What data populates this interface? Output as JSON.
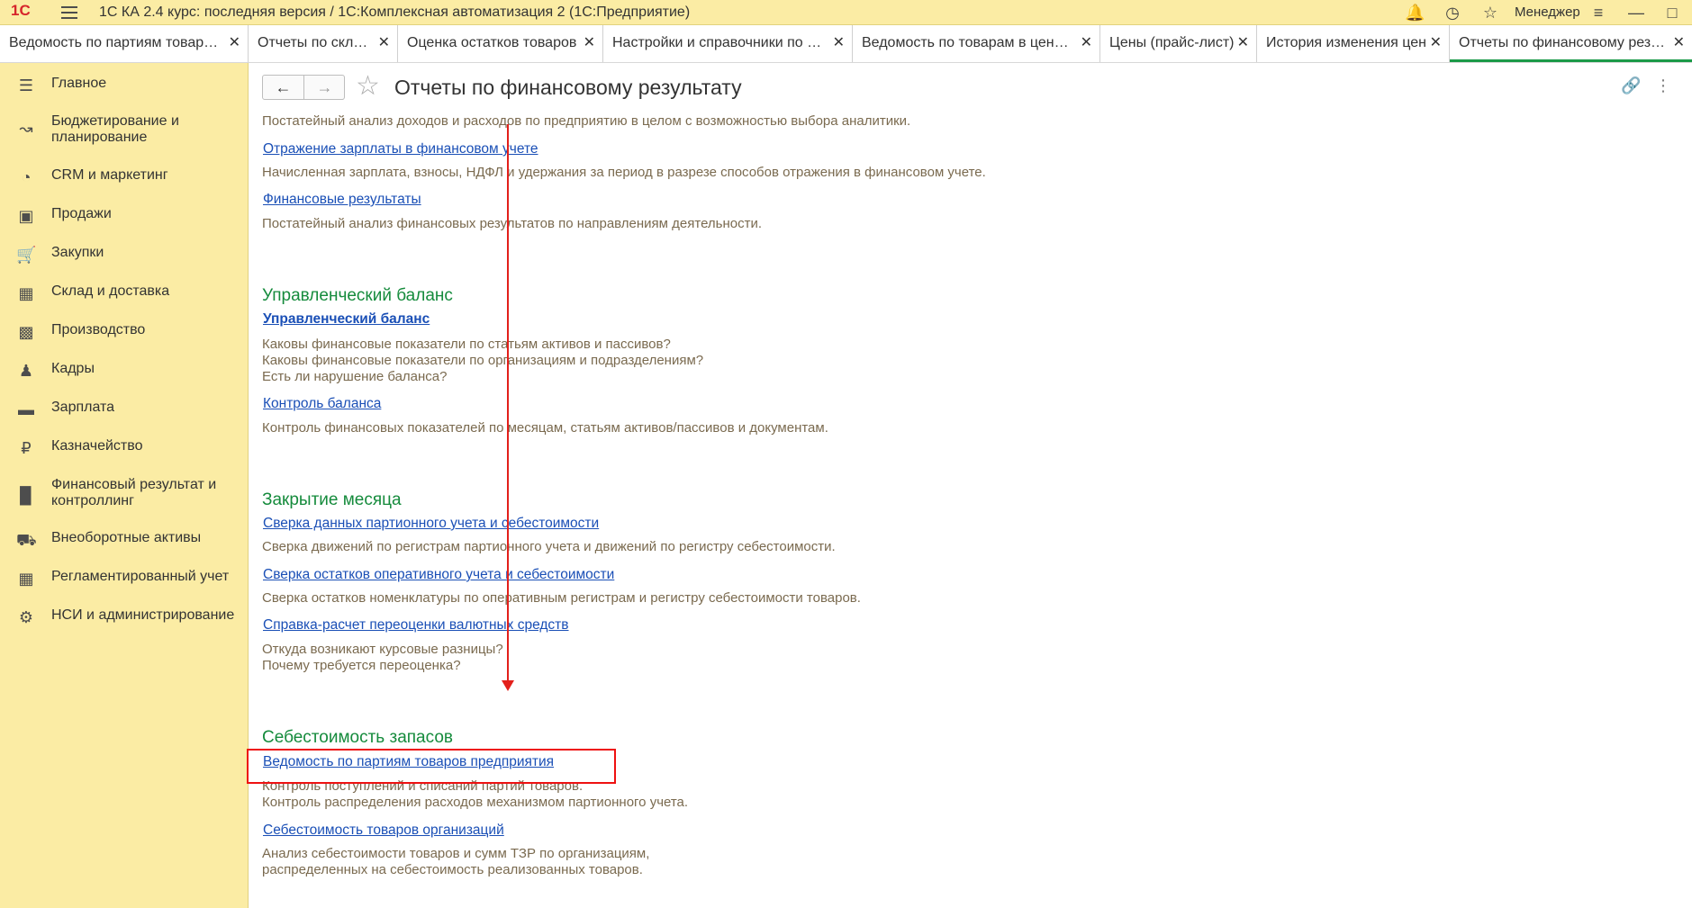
{
  "titlebar": {
    "logo": "1С",
    "title": "1С КА 2.4 курс: последняя версия / 1С:Комплексная автоматизация 2  (1С:Предприятие)",
    "user": "Менеджер"
  },
  "tabs": [
    {
      "label": "Ведомость по партиям товар…"
    },
    {
      "label": "Отчеты по складу"
    },
    {
      "label": "Оценка остатков товаров"
    },
    {
      "label": "Настройки и справочники по …"
    },
    {
      "label": "Ведомость по товарам в цен…"
    },
    {
      "label": "Цены (прайс-лист)"
    },
    {
      "label": "История изменения цен"
    },
    {
      "label": "Отчеты по финансовому резу…"
    }
  ],
  "sidebar": {
    "items": [
      {
        "label": "Главное",
        "icon": "menu-icon"
      },
      {
        "label": "Бюджетирование и планирование",
        "icon": "budget-icon"
      },
      {
        "label": "CRM и маркетинг",
        "icon": "crm-icon"
      },
      {
        "label": "Продажи",
        "icon": "bag-icon"
      },
      {
        "label": "Закупки",
        "icon": "cart-icon"
      },
      {
        "label": "Склад и доставка",
        "icon": "warehouse-icon"
      },
      {
        "label": "Производство",
        "icon": "factory-icon"
      },
      {
        "label": "Кадры",
        "icon": "person-icon"
      },
      {
        "label": "Зарплата",
        "icon": "wallet-icon"
      },
      {
        "label": "Казначейство",
        "icon": "ruble-icon"
      },
      {
        "label": "Финансовый результат и контроллинг",
        "icon": "bar-chart-icon"
      },
      {
        "label": "Внеоборотные активы",
        "icon": "truck-icon"
      },
      {
        "label": "Регламентированный учет",
        "icon": "calculator-icon"
      },
      {
        "label": "НСИ и администрирование",
        "icon": "gear-icon"
      }
    ]
  },
  "page": {
    "title": "Отчеты по финансовому результату",
    "back": "←",
    "forward": "→"
  },
  "content": {
    "intro_desc": "Постатейный анализ доходов и расходов по предприятию в целом с возможностью выбора аналитики.",
    "link_salary": "Отражение зарплаты в финансовом учете",
    "desc_salary": "Начисленная зарплата, взносы, НДФЛ и удержания за период в разрезе способов отражения в финансовом учете.",
    "link_finres": "Финансовые результаты",
    "desc_finres": "Постатейный анализ финансовых результатов по направлениям деятельности.",
    "sect_balance": "Управленческий баланс",
    "link_balance": "Управленческий баланс",
    "desc_balance_1": "Каковы финансовые показатели по статьям активов и пассивов?",
    "desc_balance_2": "Каковы финансовые показатели по организациям и подразделениям?",
    "desc_balance_3": "Есть ли нарушение баланса?",
    "link_balance_ctrl": "Контроль баланса",
    "desc_balance_ctrl": "Контроль финансовых показателей по месяцам, статьям активов/пассивов и документам.",
    "sect_close": "Закрытие месяца",
    "link_close_1": "Сверка данных партионного учета и себестоимости",
    "desc_close_1": "Сверка движений по регистрам партионного учета и движений по регистру себестоимости.",
    "link_close_2": "Сверка остатков оперативного учета и себестоимости",
    "desc_close_2": "Сверка остатков номенклатуры по оперативным регистрам и регистру себестоимости товаров.",
    "link_close_3": "Справка-расчет переоценки валютных средств",
    "desc_close_3a": "Откуда возникают курсовые разницы?",
    "desc_close_3b": "Почему требуется переоценка?",
    "sect_cost": "Себестоимость запасов",
    "link_cost_1": "Ведомость по партиям товаров предприятия",
    "desc_cost_1a": "Контроль поступлений и списаний партий товаров.",
    "desc_cost_1b": "Контроль распределения расходов механизмом партионного учета.",
    "link_cost_2": "Себестоимость товаров организаций",
    "desc_cost_2a": "Анализ себестоимости товаров и сумм ТЗР по организациям,",
    "desc_cost_2b": "распределенных на себестоимость реализованных товаров."
  },
  "colors": {
    "sidebar_bg": "#fbeca4",
    "section_header": "#158b3c",
    "link": "#1a4fb6",
    "annotation": "#e3201b",
    "tab_active": "#1b9a48"
  }
}
